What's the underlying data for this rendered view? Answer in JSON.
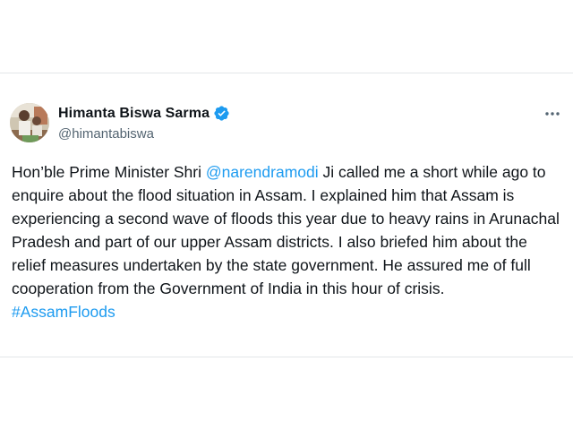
{
  "tweet": {
    "author_name": "Himanta Biswa Sarma",
    "author_handle": "@himantabiswa",
    "verified": true,
    "more_icon": "more-horizontal-icon",
    "text_before_mention": "Hon’ble Prime Minister Shri ",
    "mention": "@narendramodi",
    "text_after_mention": "  Ji called me a short while ago to enquire about the flood situation in Assam. I explained him that Assam is experiencing a second wave of floods this year due to heavy rains in Arunachal Pradesh and part of our upper Assam districts. I also briefed him about the relief measures undertaken by the state government. He assured me of full cooperation from the Government of India in this hour of crisis.",
    "hashtag": "#AssamFloods"
  },
  "colors": {
    "link": "#1d9bf0",
    "text": "#0f1419",
    "secondary_text": "#536471",
    "verified_badge": "#1d9bf0",
    "border": "#e3e6e8"
  }
}
